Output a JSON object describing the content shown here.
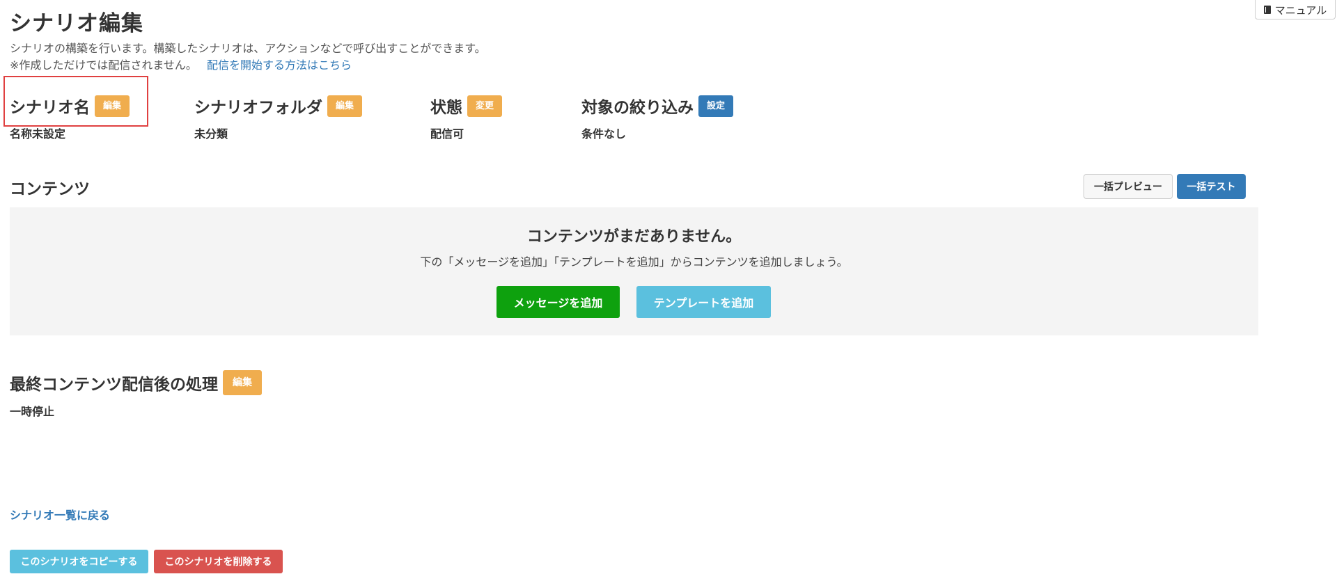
{
  "header": {
    "manual_label": "マニュアル",
    "manual_icon": "book-icon",
    "title": "シナリオ編集",
    "description": "シナリオの構築を行います。構築したシナリオは、アクションなどで呼び出すことができます。",
    "note": "※作成しただけでは配信されません。",
    "note_link": "配信を開始する方法はこちら"
  },
  "fields": {
    "name": {
      "label": "シナリオ名",
      "button": "編集",
      "value": "名称未設定"
    },
    "folder": {
      "label": "シナリオフォルダ",
      "button": "編集",
      "value": "未分類"
    },
    "status": {
      "label": "状態",
      "button": "変更",
      "value": "配信可"
    },
    "filter": {
      "label": "対象の絞り込み",
      "button": "設定",
      "value": "条件なし"
    }
  },
  "contents": {
    "title": "コンテンツ",
    "bulk_preview": "一括プレビュー",
    "bulk_test": "一括テスト",
    "empty_title": "コンテンツがまだありません。",
    "empty_desc": "下の「メッセージを追加」「テンプレートを追加」からコンテンツを追加しましょう。",
    "add_message": "メッセージを追加",
    "add_template": "テンプレートを追加"
  },
  "after_last": {
    "title": "最終コンテンツ配信後の処理",
    "button": "編集",
    "value": "一時停止"
  },
  "footer": {
    "back_link": "シナリオ一覧に戻る",
    "copy_button": "このシナリオをコピーする",
    "delete_button": "このシナリオを削除する"
  },
  "colors": {
    "orange": "#f0ad4e",
    "blue": "#337ab7",
    "green": "#0ea10e",
    "light_blue": "#5bc0de",
    "red": "#d9534f",
    "highlight_frame": "#e04040"
  }
}
